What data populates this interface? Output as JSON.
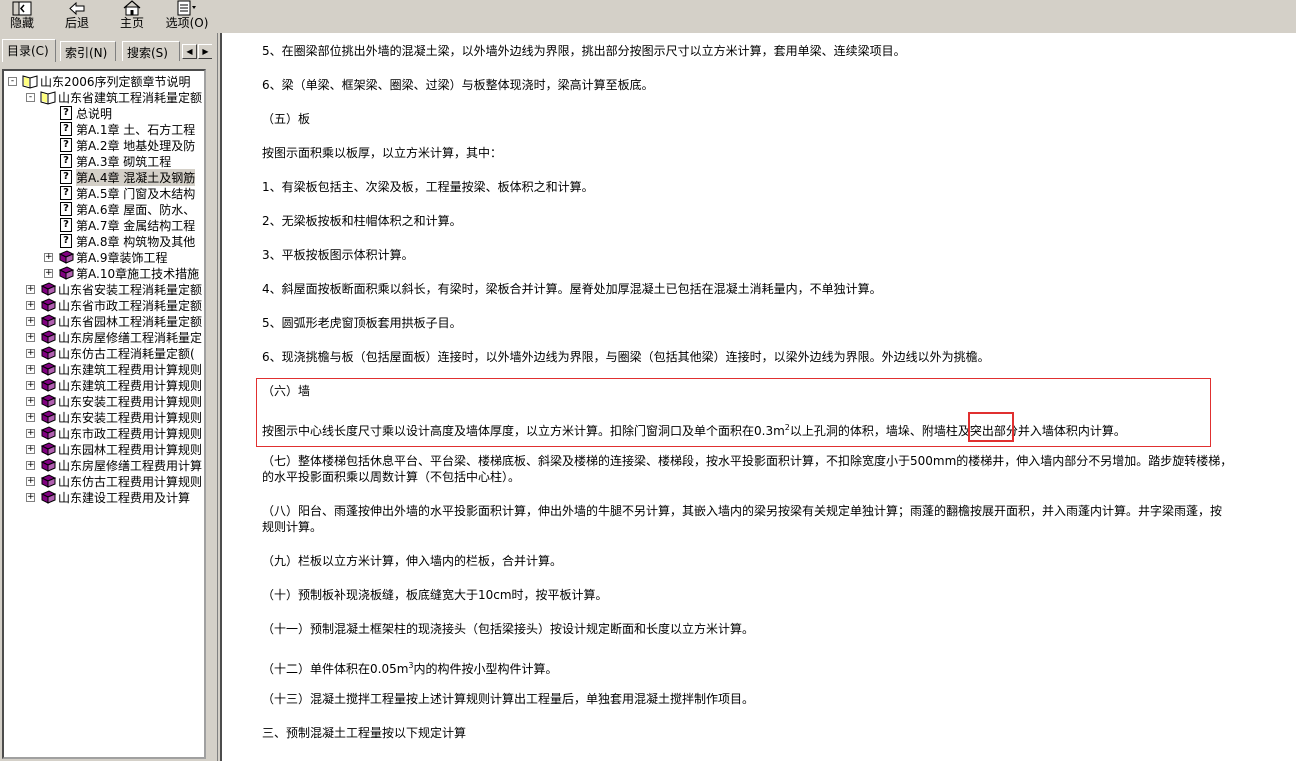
{
  "toolbar": {
    "hide": "隐藏",
    "back": "后退",
    "home": "主页",
    "options": "选项(O)"
  },
  "tabs": {
    "contents": "目录(C)",
    "index": "索引(N)",
    "search": "搜索(S)"
  },
  "tree": {
    "root": "山东2006序列定额章节说明",
    "l1_open": "山东省建筑工程消耗量定额",
    "chapters": [
      "总说明",
      "第A.1章 土、石方工程",
      "第A.2章 地基处理及防",
      "第A.3章 砌筑工程",
      "第A.4章 混凝土及钢筋",
      "第A.5章 门窗及木结构",
      "第A.6章 屋面、防水、",
      "第A.7章 金属结构工程",
      "第A.8章 构筑物及其他"
    ],
    "books": [
      "第A.9章装饰工程",
      "第A.10章施工技术措施"
    ],
    "others": [
      "山东省安装工程消耗量定额",
      "山东省市政工程消耗量定额",
      "山东省园林工程消耗量定额",
      "山东房屋修缮工程消耗量定",
      "山东仿古工程消耗量定额(",
      "山东建筑工程费用计算规则",
      "山东建筑工程费用计算规则",
      "山东安装工程费用计算规则",
      "山东安装工程费用计算规则",
      "山东市政工程费用计算规则",
      "山东园林工程费用计算规则",
      "山东房屋修缮工程费用计算",
      "山东仿古工程费用计算规则",
      "山东建设工程费用及计算"
    ]
  },
  "content": {
    "p1": "5、在圈梁部位挑出外墙的混凝土梁，以外墙外边线为界限，挑出部分按图示尺寸以立方米计算，套用单梁、连续梁项目。",
    "p2": "6、梁（单梁、框架梁、圈梁、过梁）与板整体现浇时，梁高计算至板底。",
    "p3": "（五）板",
    "p4": "按图示面积乘以板厚，以立方米计算，其中：",
    "p5": "1、有梁板包括主、次梁及板，工程量按梁、板体积之和计算。",
    "p6": "2、无梁板按板和柱帽体积之和计算。",
    "p7": "3、平板按板图示体积计算。",
    "p8": "4、斜屋面按板断面积乘以斜长，有梁时，梁板合并计算。屋脊处加厚混凝土已包括在混凝土消耗量内，不单独计算。",
    "p9": "5、圆弧形老虎窗顶板套用拱板子目。",
    "p10": "6、现浇挑檐与板（包括屋面板）连接时，以外墙外边线为界限，与圈梁（包括其他梁）连接时，以梁外边线为界限。外边线以外为挑檐。",
    "p11": "（六）墙",
    "p12a": "按图示中心线长度尺寸乘以设计高度及墙体厚度，以立方米计算。扣除门窗洞口及单个面积在0.3m",
    "p12sup": "2",
    "p12b": "以上孔洞的体积，墙垛、",
    "p12c": "附墙柱",
    "p12d": "及突出部分并入墙体积内计算。",
    "p13a": "（七）整体楼梯包括休息平台、平台梁、楼梯底板、斜梁及楼梯的连接梁、楼梯段，按水平投影面积计算，不扣除宽度小于500mm的楼梯井，伸入墙内部分不另增加。踏步旋转楼梯，",
    "p13b": "的水平投影面积乘以周数计算（不包括中心柱）。",
    "p14a": "（八）阳台、雨蓬按伸出外墙的水平投影面积计算，伸出外墙的牛腿不另计算，其嵌入墙内的梁另按梁有关规定单独计算；雨蓬的翻檐按展开面积，并入雨蓬内计算。井字梁雨蓬，按",
    "p14b": "规则计算。",
    "p15": "（九）栏板以立方米计算，伸入墙内的栏板，合并计算。",
    "p16": "（十）预制板补现浇板缝，板底缝宽大于10cm时，按平板计算。",
    "p17": "（十一）预制混凝土框架柱的现浇接头（包括梁接头）按设计规定断面和长度以立方米计算。",
    "p18a": "（十二）单件体积在0.05m",
    "p18sup": "3",
    "p18b": "内的构件按小型构件计算。",
    "p19": "（十三）混凝土搅拌工程量按上述计算规则计算出工程量后，单独套用混凝土搅拌制作项目。",
    "p20": "三、预制混凝土工程量按以下规定计算"
  }
}
